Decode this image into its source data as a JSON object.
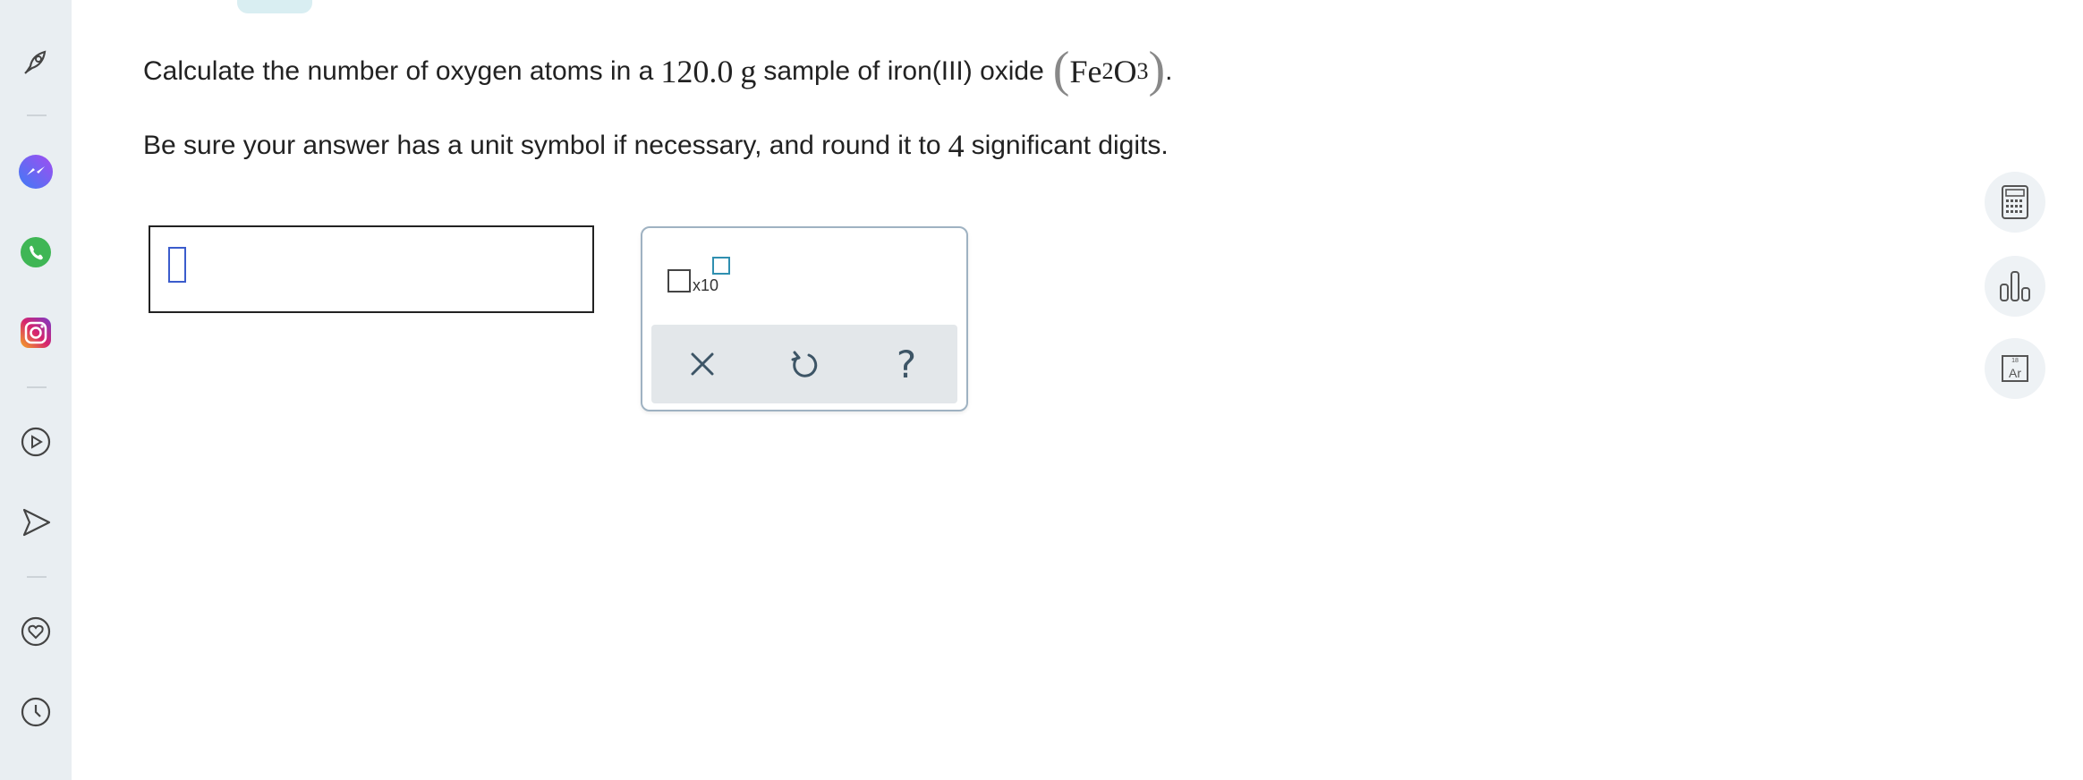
{
  "question": {
    "prefix": "Calculate the number of oxygen atoms in a",
    "mass_value": "120.0",
    "mass_unit": "g",
    "middle": "sample of iron(III) oxide",
    "formula_open": "(",
    "formula_fe": "Fe",
    "formula_fe_sub": "2",
    "formula_o": "O",
    "formula_o_sub": "3",
    "formula_close": ")",
    "end": "."
  },
  "instruction": {
    "prefix": "Be sure your answer has a unit symbol if necessary, and round it to",
    "digits": "4",
    "suffix": "significant digits."
  },
  "answer": {
    "value": ""
  },
  "palette": {
    "sci_label": "x10",
    "buttons": [
      "clear",
      "undo",
      "help"
    ],
    "help_label": "?"
  },
  "tools": {
    "periodic_label_top": "18",
    "periodic_label": "Ar"
  },
  "left_rail": {
    "icons": [
      "rocket-icon",
      "messenger-icon",
      "whatsapp-icon",
      "instagram-icon",
      "play-icon",
      "send-icon",
      "heart-icon",
      "history-icon"
    ]
  },
  "colors": {
    "rail_bg": "#e9eef2",
    "messenger": "#6a5cf0",
    "whatsapp": "#3fb655",
    "instagram": "#c0307a",
    "cursor": "#3b5ccc",
    "exponent_box": "#2f8fb0"
  }
}
